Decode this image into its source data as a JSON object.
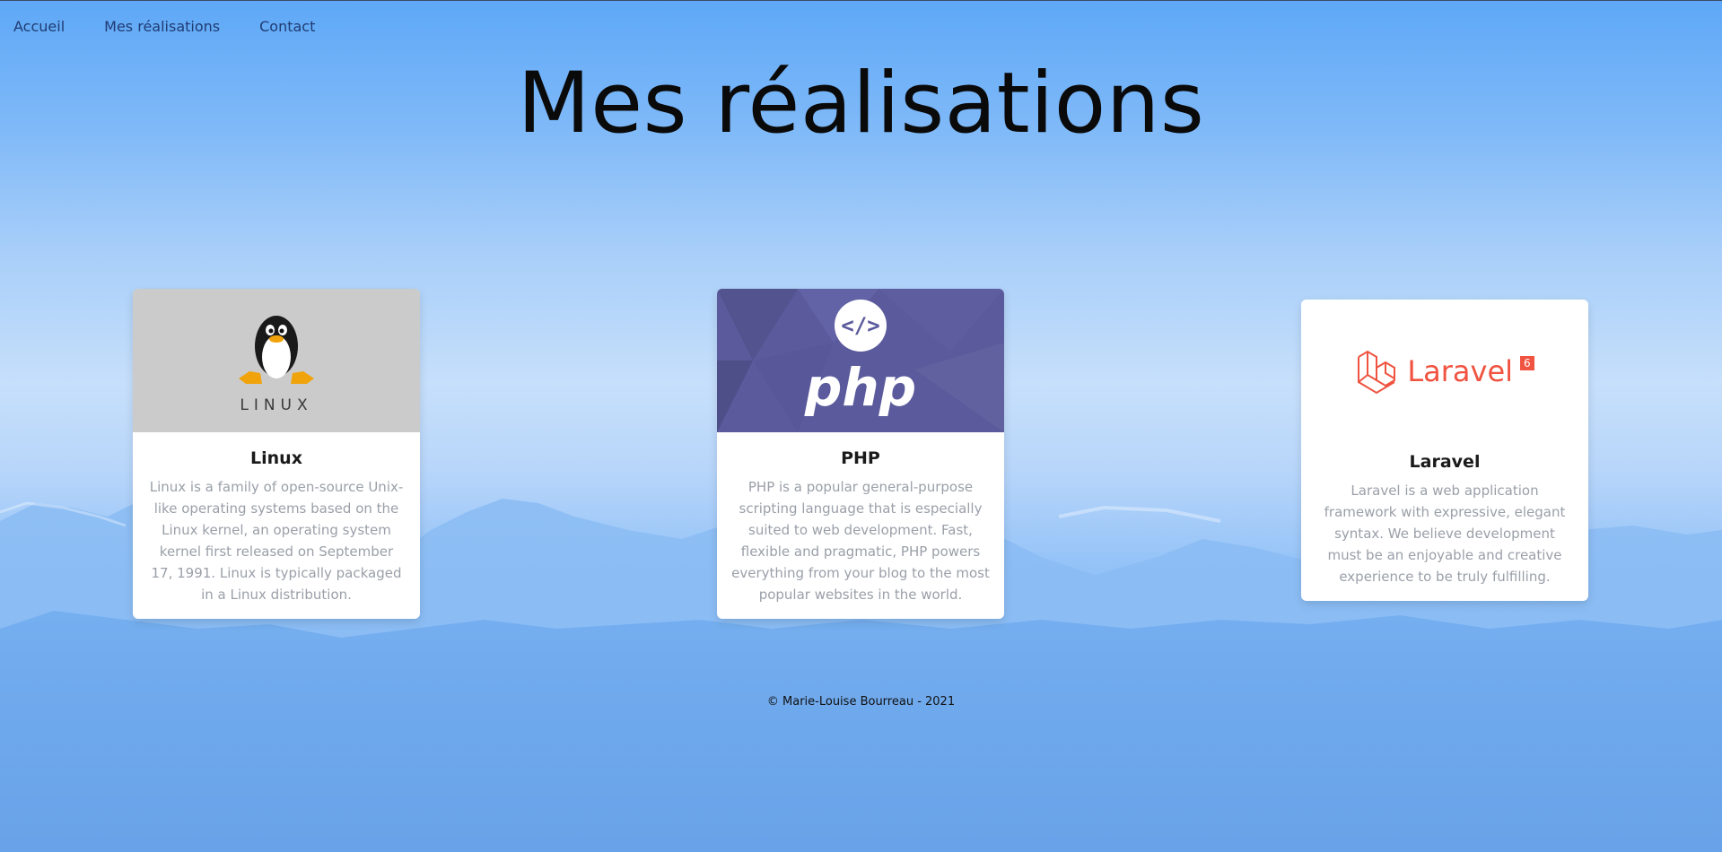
{
  "nav": {
    "items": [
      {
        "label": "Accueil"
      },
      {
        "label": "Mes réalisations"
      },
      {
        "label": "Contact"
      }
    ]
  },
  "header": {
    "title": "Mes réalisations"
  },
  "cards": [
    {
      "title": "Linux",
      "logo_text": "LINUX",
      "icon": "tux-penguin-icon",
      "media_color": "#cbcbcb",
      "description": "Linux is a family of open-source Unix-like operating systems based on the Linux kernel, an operating system kernel first released on September 17, 1991. Linux is typically packaged in a Linux distribution."
    },
    {
      "title": "PHP",
      "logo_text": "php",
      "icon": "code-icon",
      "media_color": "#5a5a9c",
      "description": "PHP is a popular general-purpose scripting language that is especially suited to web development. Fast, flexible and pragmatic, PHP powers everything from your blog to the most popular websites in the world."
    },
    {
      "title": "Laravel",
      "logo_text": "Laravel",
      "logo_badge": "6",
      "icon": "laravel-cube-icon",
      "brand_color": "#f05340",
      "description": "Laravel is a web application framework with expressive, elegant syntax. We believe development must be an enjoyable and creative experience to be truly fulfilling."
    }
  ],
  "footer": {
    "text": "© Marie-Louise Bourreau - 2021"
  }
}
